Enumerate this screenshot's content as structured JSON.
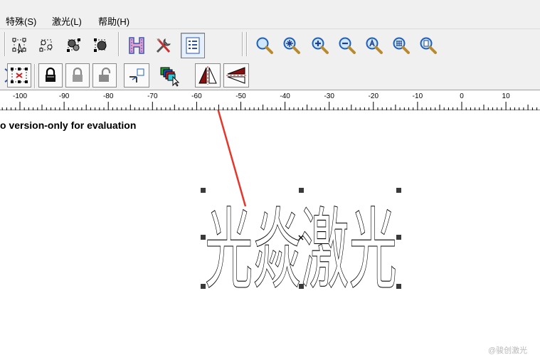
{
  "menu": {
    "items": [
      {
        "label": "特殊(S)"
      },
      {
        "label": "激光(L)"
      },
      {
        "label": "帮助(H)"
      }
    ]
  },
  "ruler": {
    "labels": [
      "-100",
      "-90",
      "-80",
      "-70",
      "-60",
      "-50",
      "-40",
      "-30",
      "-20",
      "-10",
      "0",
      "10"
    ]
  },
  "canvas": {
    "evaluation_text": "o version-only for evaluation",
    "text_object": "光焱激光"
  },
  "watermark": "@骏创激光",
  "colors": {
    "toolbar_bg": "#f0f0f0",
    "arrow_annotation": "#e8352a",
    "handle": "#3a3a3a"
  },
  "icons": {
    "toolbar1": [
      "node-edit-icon",
      "node-sub-icon",
      "node-join-icon",
      "node-break-icon",
      "hatch-h-icon",
      "tools-icon",
      "properties-list-icon",
      "zoom-icon",
      "zoom-all-icon",
      "zoom-in-icon",
      "zoom-out-icon",
      "zoom-select-icon",
      "zoom-object-icon",
      "zoom-page-icon"
    ],
    "toolbar2": [
      "group-icon",
      "select-area-icon",
      "lock-icon",
      "lock-gray-icon",
      "unlock-icon",
      "origin-icon",
      "layers-icon",
      "mirror-horizontal-icon",
      "mirror-vertical-icon"
    ]
  }
}
